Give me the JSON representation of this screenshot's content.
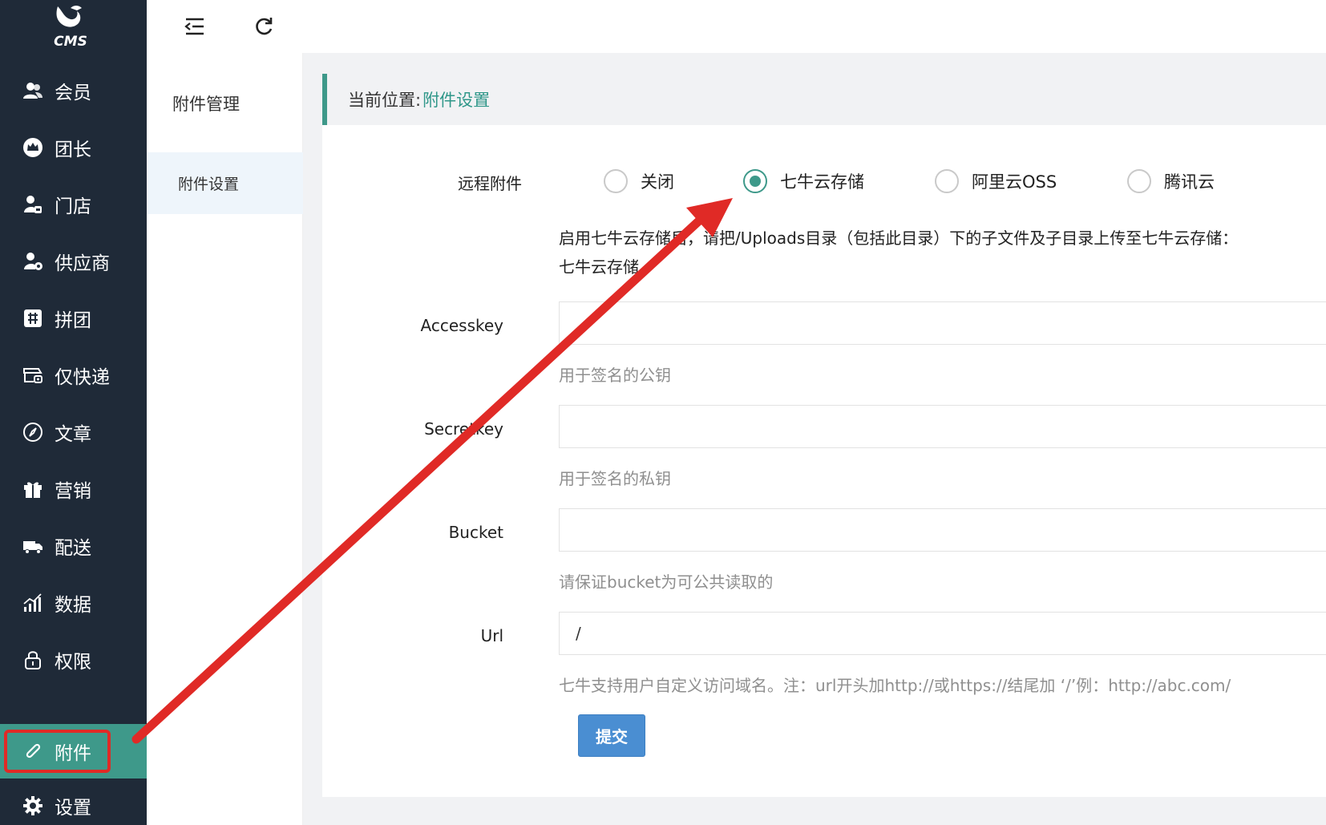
{
  "brand": {
    "logo_text": "CMS"
  },
  "sidebar": {
    "items": [
      {
        "label": "会员",
        "icon": "users-icon"
      },
      {
        "label": "团长",
        "icon": "crown-icon"
      },
      {
        "label": "门店",
        "icon": "store-user-icon"
      },
      {
        "label": "供应商",
        "icon": "supplier-icon"
      },
      {
        "label": "拼团",
        "icon": "group-buy-icon"
      },
      {
        "label": "仅快递",
        "icon": "express-icon"
      },
      {
        "label": "文章",
        "icon": "compass-icon"
      },
      {
        "label": "营销",
        "icon": "gift-icon"
      },
      {
        "label": "配送",
        "icon": "truck-icon"
      },
      {
        "label": "数据",
        "icon": "bar-chart-icon"
      },
      {
        "label": "权限",
        "icon": "lock-icon"
      },
      {
        "label": "附件",
        "icon": "paperclip-icon"
      },
      {
        "label": "设置",
        "icon": "gear-icon"
      }
    ],
    "active_index": 11
  },
  "topbar": {
    "collapse_icon": "menu-collapse-icon",
    "refresh_icon": "refresh-icon"
  },
  "submenu": {
    "title": "附件管理",
    "active_item": "附件设置"
  },
  "breadcrumb": {
    "prefix": "当前位置:",
    "current": "附件设置"
  },
  "form": {
    "remote_label": "远程附件",
    "options": [
      {
        "label": "关闭",
        "checked": false
      },
      {
        "label": "七牛云存储",
        "checked": true
      },
      {
        "label": "阿里云OSS",
        "checked": false
      },
      {
        "label": "腾讯云",
        "checked": false
      }
    ],
    "tip_line1": "启用七牛云存储后，请把/Uploads目录（包括此目录）下的子文件及子目录上传至七牛云存储：",
    "tip_line2": "七牛云存储",
    "fields": [
      {
        "label": "Accesskey",
        "value": "",
        "hint": "用于签名的公钥"
      },
      {
        "label": "Secretkey",
        "value": "",
        "hint": "用于签名的私钥"
      },
      {
        "label": "Bucket",
        "value": "",
        "hint": "请保证bucket为可公共读取的"
      },
      {
        "label": "Url",
        "value": "/",
        "hint": "七牛支持用户自定义访问域名。注：url开头加http://或https://结尾加 ‘/’例：http://abc.com/"
      }
    ],
    "submit_label": "提交"
  },
  "colors": {
    "sidebar_bg": "#1f2a38",
    "accent": "#3e998a",
    "annotation": "#e02a26",
    "button": "#4a8ed2"
  }
}
